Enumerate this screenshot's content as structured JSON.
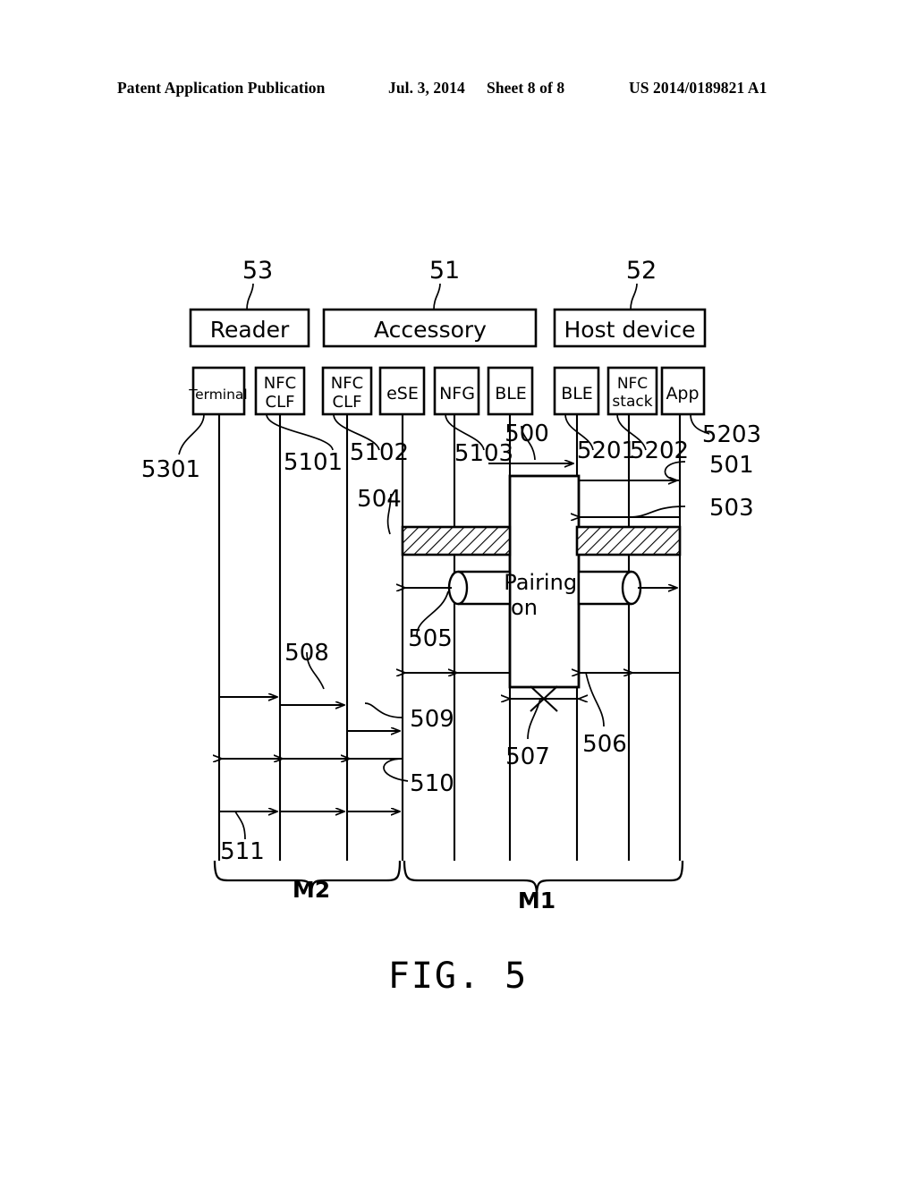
{
  "header": {
    "publication": "Patent Application Publication",
    "date": "Jul. 3, 2014",
    "sheet": "Sheet 8 of 8",
    "patent_number": "US 2014/0189821 A1"
  },
  "figure": {
    "caption": "FIG. 5",
    "top_entities": [
      {
        "label": "Reader",
        "ref": "53"
      },
      {
        "label": "Accessory",
        "ref": "51"
      },
      {
        "label": "Host  device",
        "ref": "52"
      }
    ],
    "lifelines": [
      {
        "label": "Terminal",
        "ref": "5301"
      },
      {
        "label": "NFC\nCLF",
        "ref": "5101"
      },
      {
        "label": "NFC\nCLF",
        "ref": "5102"
      },
      {
        "label": "eSE",
        "ref": "504"
      },
      {
        "label": "NFG",
        "ref": "5103"
      },
      {
        "label": "BLE",
        "ref": "500"
      },
      {
        "label": "BLE",
        "ref": "5201"
      },
      {
        "label": "NFC\nstack",
        "ref": "5202"
      },
      {
        "label": "App",
        "ref": "5203"
      }
    ],
    "lifeline_labels": {
      "terminal": "Terminal",
      "nfc_clf_reader": "NFC\nCLF",
      "nfc_clf_accessory": "NFC\nCLF",
      "ese": "eSE",
      "nfg": "NFG",
      "ble_accessory": "BLE",
      "ble_host": "BLE",
      "nfc_stack": "NFC\nstack",
      "app": "App"
    },
    "reference_numerals": {
      "n5301": "5301",
      "n5101": "5101",
      "n5102": "5102",
      "n5103": "5103",
      "n500": "500",
      "n5201": "5201",
      "n5202": "5202",
      "n5203": "5203",
      "n501": "501",
      "n503": "503",
      "n504": "504",
      "n505": "505",
      "n506": "506",
      "n507": "507",
      "n508": "508",
      "n509": "509",
      "n510": "510",
      "n511": "511",
      "n53": "53",
      "n51": "51",
      "n52": "52"
    },
    "pairing_box": {
      "line1": "Pairing",
      "line2": "on"
    },
    "braces": [
      {
        "label": "M2"
      },
      {
        "label": "M1"
      }
    ],
    "brace_labels": {
      "m2": "M2",
      "m1": "M1"
    },
    "colors": {
      "stroke": "#000000",
      "background": "#ffffff"
    }
  }
}
